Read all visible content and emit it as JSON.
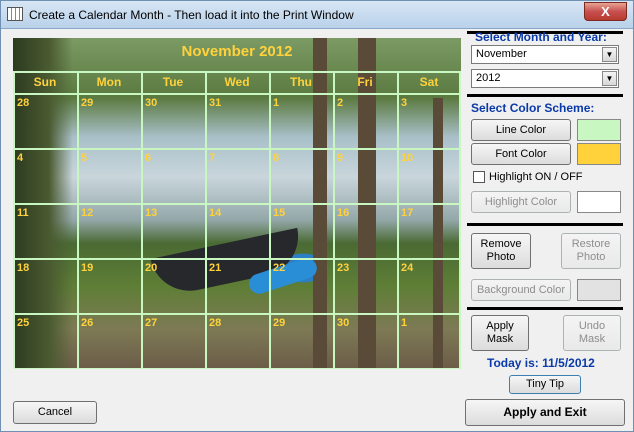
{
  "window": {
    "title": "Create a Calendar Month - Then load it into the Print Window",
    "close_glyph": "X"
  },
  "calendar": {
    "month_title": "November 2012",
    "day_headers": [
      "Sun",
      "Mon",
      "Tue",
      "Wed",
      "Thu",
      "Fri",
      "Sat"
    ],
    "weeks": [
      [
        "28",
        "29",
        "30",
        "31",
        "1",
        "2",
        "3"
      ],
      [
        "4",
        "5",
        "6",
        "7",
        "8",
        "9",
        "10"
      ],
      [
        "11",
        "12",
        "13",
        "14",
        "15",
        "16",
        "17"
      ],
      [
        "18",
        "19",
        "20",
        "21",
        "22",
        "23",
        "24"
      ],
      [
        "25",
        "26",
        "27",
        "28",
        "29",
        "30",
        "1"
      ]
    ],
    "line_color": "#c9f7c2",
    "font_color": "#ffd23c"
  },
  "panel": {
    "select_label": "Select Month and Year:",
    "month_value": "November",
    "year_value": "2012",
    "color_scheme_label": "Select Color Scheme:",
    "line_color_btn": "Line Color",
    "font_color_btn": "Font Color",
    "line_swatch": "#c9f7c2",
    "font_swatch": "#ffd23c",
    "highlight_toggle": "Highlight ON / OFF",
    "highlight_color_btn": "Highlight Color",
    "remove_photo_btn": "Remove\nPhoto",
    "restore_photo_btn": "Restore\nPhoto",
    "background_color_btn": "Background Color",
    "apply_mask_btn": "Apply\nMask",
    "undo_mask_btn": "Undo\nMask",
    "today_label": "Today is: 11/5/2012",
    "tiny_tip_btn": "Tiny Tip"
  },
  "footer": {
    "cancel_btn": "Cancel",
    "apply_exit_btn": "Apply and Exit"
  }
}
